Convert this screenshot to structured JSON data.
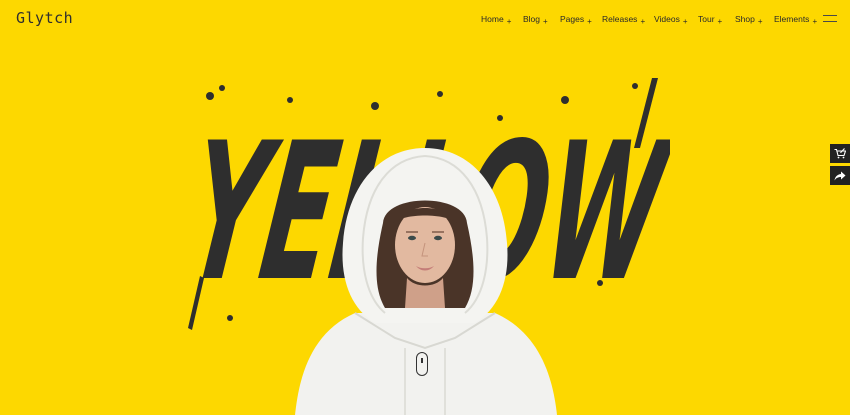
{
  "header": {
    "logo": "Glytch",
    "nav": [
      {
        "label": "Home"
      },
      {
        "label": "Blog"
      },
      {
        "label": "Pages"
      },
      {
        "label": "Releases"
      },
      {
        "label": "Videos"
      },
      {
        "label": "Tour"
      },
      {
        "label": "Shop"
      },
      {
        "label": "Elements"
      }
    ],
    "nav_marker": "+",
    "menu_icon": "hamburger-icon"
  },
  "hero": {
    "headline": "YELLOW",
    "image": "woman-in-white-hoodie",
    "scroll_icon": "mouse-scroll-icon"
  },
  "side_buttons": [
    {
      "icon": "cart-icon"
    },
    {
      "icon": "share-arrow-icon"
    }
  ],
  "colors": {
    "background": "#fdd800",
    "headline": "#2e2e2e",
    "hoodie": "#f2f2ef"
  }
}
